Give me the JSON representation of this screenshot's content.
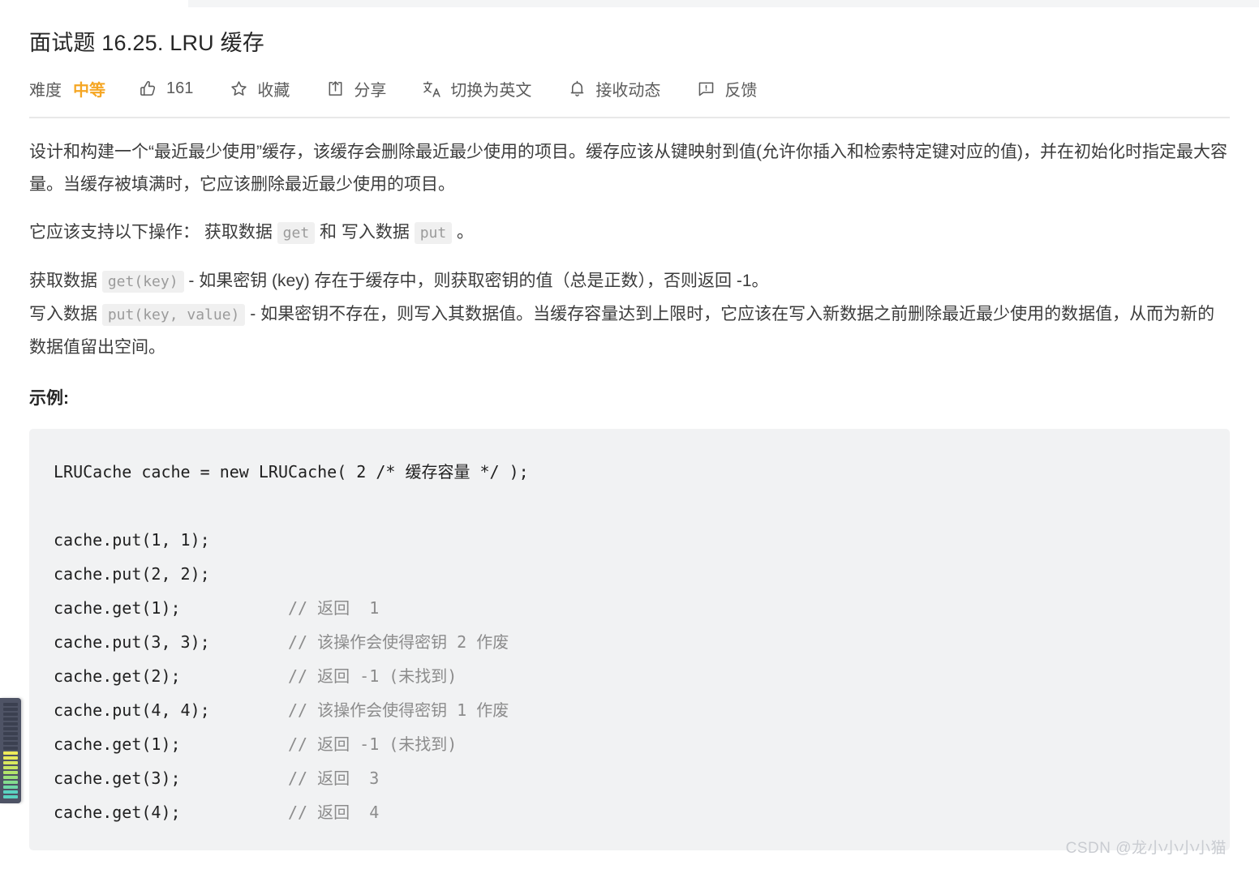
{
  "page": {
    "title": "面试题 16.25. LRU 缓存",
    "watermark": "CSDN @龙小小小小猫"
  },
  "toolbar": {
    "difficulty_label": "难度",
    "difficulty_value": "中等",
    "difficulty_color": "#f5a623",
    "items": [
      {
        "icon": "thumbs-up-icon",
        "label": "161"
      },
      {
        "icon": "star-icon",
        "label": "收藏"
      },
      {
        "icon": "share-icon",
        "label": "分享"
      },
      {
        "icon": "translate-icon",
        "label": "切换为英文"
      },
      {
        "icon": "bell-icon",
        "label": "接收动态"
      },
      {
        "icon": "feedback-icon",
        "label": "反馈"
      }
    ]
  },
  "description": {
    "para1": "设计和构建一个“最近最少使用”缓存，该缓存会删除最近最少使用的项目。缓存应该从键映射到值(允许你插入和检索特定键对应的值)，并在初始化时指定最大容量。当缓存被填满时，它应该删除最近最少使用的项目。",
    "para2_prefix": "它应该支持以下操作： 获取数据 ",
    "para2_code1": "get",
    "para2_middle": " 和 写入数据 ",
    "para2_code2": "put",
    "para2_suffix": " 。",
    "para3_prefix": "获取数据 ",
    "para3_code": "get(key)",
    "para3_suffix": " - 如果密钥 (key) 存在于缓存中，则获取密钥的值（总是正数），否则返回 -1。",
    "para4_prefix": "写入数据 ",
    "para4_code": "put(key, value)",
    "para4_suffix": " - 如果密钥不存在，则写入其数据值。当缓存容量达到上限时，它应该在写入新数据之前删除最近最少使用的数据值，从而为新的数据值留出空间。",
    "example_heading": "示例:"
  },
  "code_block": {
    "lines": [
      {
        "code": "LRUCache cache = new LRUCache( 2 /* 缓存容量 */ );",
        "comment": ""
      },
      {
        "code": "",
        "comment": ""
      },
      {
        "code": "cache.put(1, 1);",
        "comment": ""
      },
      {
        "code": "cache.put(2, 2);",
        "comment": ""
      },
      {
        "code": "cache.get(1);",
        "comment": "// 返回  1"
      },
      {
        "code": "cache.put(3, 3);",
        "comment": "// 该操作会使得密钥 2 作废"
      },
      {
        "code": "cache.get(2);",
        "comment": "// 返回 -1 (未找到)"
      },
      {
        "code": "cache.put(4, 4);",
        "comment": "// 该操作会使得密钥 1 作废"
      },
      {
        "code": "cache.get(1);",
        "comment": "// 返回 -1 (未找到)"
      },
      {
        "code": "cache.get(3);",
        "comment": "// 返回  3"
      },
      {
        "code": "cache.get(4);",
        "comment": "// 返回  4"
      }
    ]
  },
  "level_widget": {
    "bars": [
      "#5ad3c0",
      "#5ad3c0",
      "#6ed9a6",
      "#83dd8e",
      "#9ae07a",
      "#b2e36a",
      "#c6e663",
      "#d8e85e",
      "#e6e95c",
      "#eeea5a",
      "#3b4050",
      "#3b4050",
      "#3b4050",
      "#3b4050",
      "#3b4050",
      "#3b4050",
      "#3b4050",
      "#3b4050",
      "#3b4050",
      "#3b4050"
    ]
  }
}
